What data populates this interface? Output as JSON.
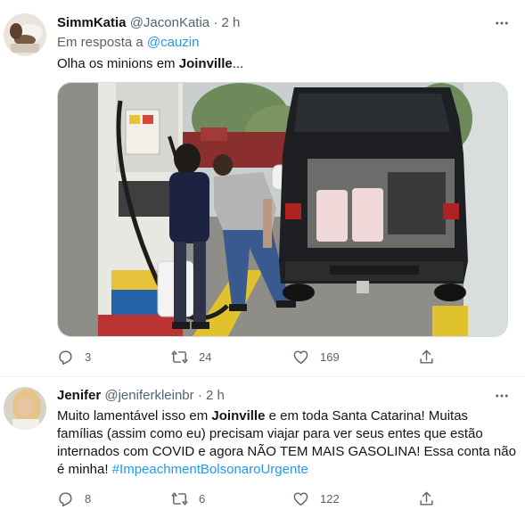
{
  "tweets": [
    {
      "author_name": "SimmKatia",
      "handle": "@JaconKatia",
      "separator": "·",
      "time": "2 h",
      "reply_prefix": "Em resposta a",
      "reply_to": "@cauzin",
      "text_before": "Olha os minions em ",
      "text_bold": "Joinville",
      "text_after": "...",
      "stats": {
        "replies": "3",
        "retweets": "24",
        "likes": "169"
      }
    },
    {
      "author_name": "Jenifer",
      "handle": "@jeniferkleinbr",
      "separator": "·",
      "time": "2 h",
      "line1_before": "Muito lamentável isso em ",
      "line1_bold": "Joinville",
      "line1_after": " e em toda Santa Catarina! Muitas",
      "line2": "famílias (assim como eu) precisam viajar para ver seus entes que estão",
      "line3": "internados com COVID e agora NÃO TEM MAIS GASOLINA! Essa conta não",
      "line4_before": "é minha! ",
      "hashtag": "#ImpeachmentBolsonaroUrgente",
      "stats": {
        "replies": "8",
        "retweets": "6",
        "likes": "122"
      }
    }
  ],
  "colors": {
    "accent": "#1d9bf0",
    "muted": "#536471",
    "text": "#0f1419",
    "border": "#eff3f4"
  },
  "icons": [
    "more-icon",
    "reply-icon",
    "retweet-icon",
    "like-icon",
    "share-icon"
  ]
}
